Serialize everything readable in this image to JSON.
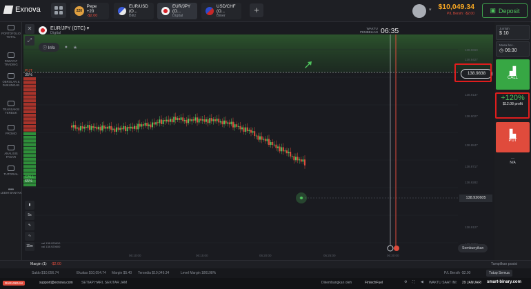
{
  "app": {
    "name": "Exnova"
  },
  "tabs": [
    {
      "badge": "220",
      "label": "Pepe +20",
      "sub": "-$2.00",
      "active": false
    },
    {
      "label": "EUR/USD (O...",
      "sub": "Blitz",
      "active": false
    },
    {
      "label": "EUR/JPY (O...",
      "sub": "Digital",
      "active": true
    },
    {
      "label": "USD/CHF (O...",
      "sub": "Biner",
      "active": false
    }
  ],
  "account": {
    "balance": "$10,049.34",
    "pnl": "P/L Bersih: -$2.00",
    "deposit_label": "Deposit"
  },
  "sidebar": {
    "items": [
      {
        "label": "PORTOFOLIO TOTAL",
        "badge": "3"
      },
      {
        "label": "RIWAYAT TRADING"
      },
      {
        "label": "OBROLAN & DUKUNGAN"
      },
      {
        "label": "TRANSAKSI TERBUK"
      },
      {
        "label": "PROMO"
      },
      {
        "label": "ANALISIS PASAR"
      },
      {
        "label": "TUTORIAL"
      },
      {
        "label": "LEBIH BANYAK"
      }
    ]
  },
  "asset": {
    "name": "EUR/JPY (OTC)",
    "type": "Digital",
    "info_label": "Info"
  },
  "expiry": {
    "label1": "WAKTU",
    "label2": "PEMBELIAN",
    "time": "06:35"
  },
  "price": {
    "tag": "138.9838",
    "current": "138.920605"
  },
  "yaxis": [
    "138.9669",
    "138.9427",
    "138.9137",
    "138.9027",
    "138.8847",
    "138.8717",
    "138.9282",
    "138.9127",
    "138.8892"
  ],
  "xaxis": [
    "06:10:00",
    "06:15:00",
    "06:20:00",
    "06:25:00",
    "06:30:00"
  ],
  "sentiment": {
    "put_label": "PUT",
    "put_pct": "35%",
    "call_label": "CALL",
    "call_pct": "65%"
  },
  "timeframe": {
    "intervals": [
      "5s",
      "15m"
    ]
  },
  "ohlc": {
    "line1": "val 138.920610",
    "line2": "val 138.920600"
  },
  "hide_label": "Sembunyikan",
  "right_panel": {
    "amount_label": "Jumlah",
    "amount": "10",
    "time_label": "Masa ber...",
    "time": "06:30",
    "call_label": "CALL",
    "profit_pct": "+120%",
    "profit_amt": "$12.08 profit",
    "put_label": "PUT",
    "na": "N/A"
  },
  "status": {
    "margin": "Margin (1)",
    "margin_val": "-$2.00",
    "show_pos": "Tampilkan posisi"
  },
  "status2": {
    "saldo": "Saldo $10,056.74",
    "ekuitas": "Ekuitas $10,054.74",
    "margin": "Margin $5.40",
    "tersedia": "Tersedia $10,049.34",
    "level": "Level Margin 186198%",
    "pl": "P/L Bersih -$2.00",
    "close_all": "Tutup Semua"
  },
  "footer": {
    "tag": "DUKUNGAN",
    "email": "support@exnova.com",
    "hours": "SETIAP HARI, SEKITAR JAM",
    "dev": "Dikembangkan oleh",
    "dev_name": "FintechFuel",
    "time_label": "WAKTU SAAT INI:",
    "time": "29 JANUARI",
    "watermark": "smart-binary.com"
  },
  "colors": {
    "up": "#4fc35d",
    "down": "#e04b3c",
    "accent": "#f5a623"
  }
}
